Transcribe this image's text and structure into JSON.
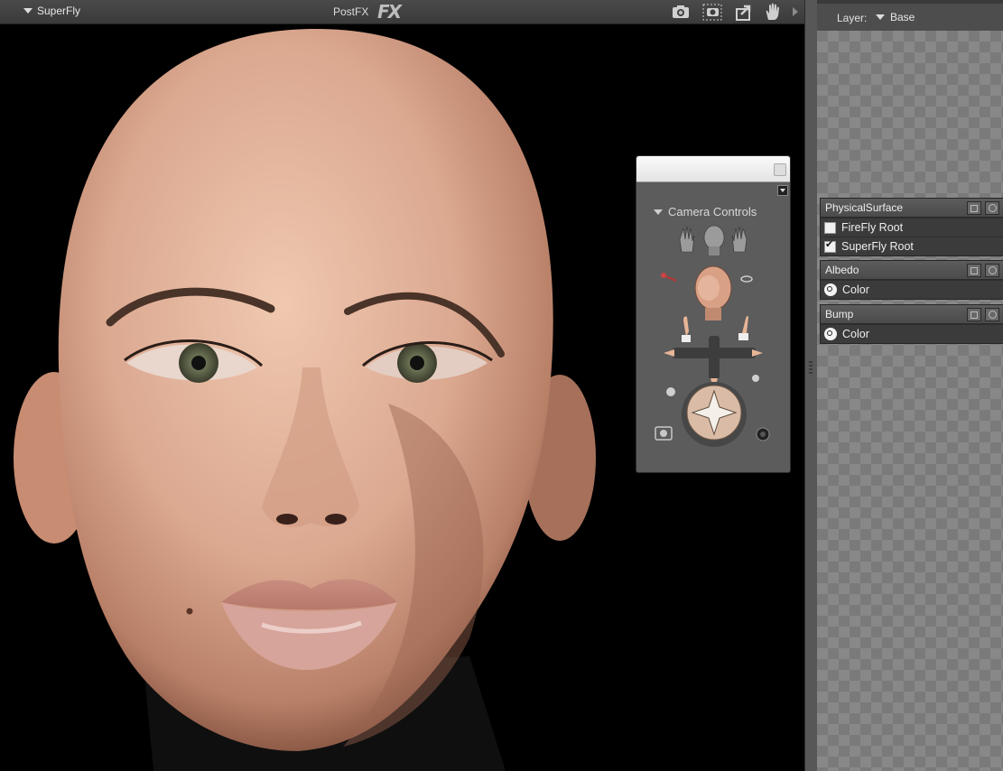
{
  "toolbar": {
    "render_engine": "SuperFly",
    "postfx_label": "PostFX",
    "fx_logo": "FX",
    "icons": [
      "camera-icon",
      "area-render-icon",
      "export-icon",
      "hand-pan-icon",
      "expand-arrow-icon"
    ]
  },
  "camera_controls": {
    "title": "Camera Controls",
    "icons": [
      "left-hand-camera-icon",
      "head-camera-icon",
      "right-hand-camera-icon",
      "face-camera-icon",
      "move-hands-icon",
      "trackball-icon",
      "snapshot-camera-icon",
      "zoom-dial-icon"
    ]
  },
  "material_room": {
    "layer_label": "Layer:",
    "layer_value": "Base",
    "nodes": [
      {
        "title": "PhysicalSurface",
        "rows": [
          {
            "label": "FireFly Root",
            "checked": false
          },
          {
            "label": "SuperFly Root",
            "checked": true
          }
        ]
      },
      {
        "title": "Albedo",
        "rows": [
          {
            "label": "Color"
          }
        ]
      },
      {
        "title": "Bump",
        "rows": [
          {
            "label": "Color"
          }
        ]
      }
    ]
  },
  "colors": {
    "toolbar_bg": "#3f3f3f",
    "panel_bg": "#4d4d4d",
    "node_header": "#545454",
    "viewport_bg": "#000000",
    "skin_tone": "#e2b59c"
  }
}
